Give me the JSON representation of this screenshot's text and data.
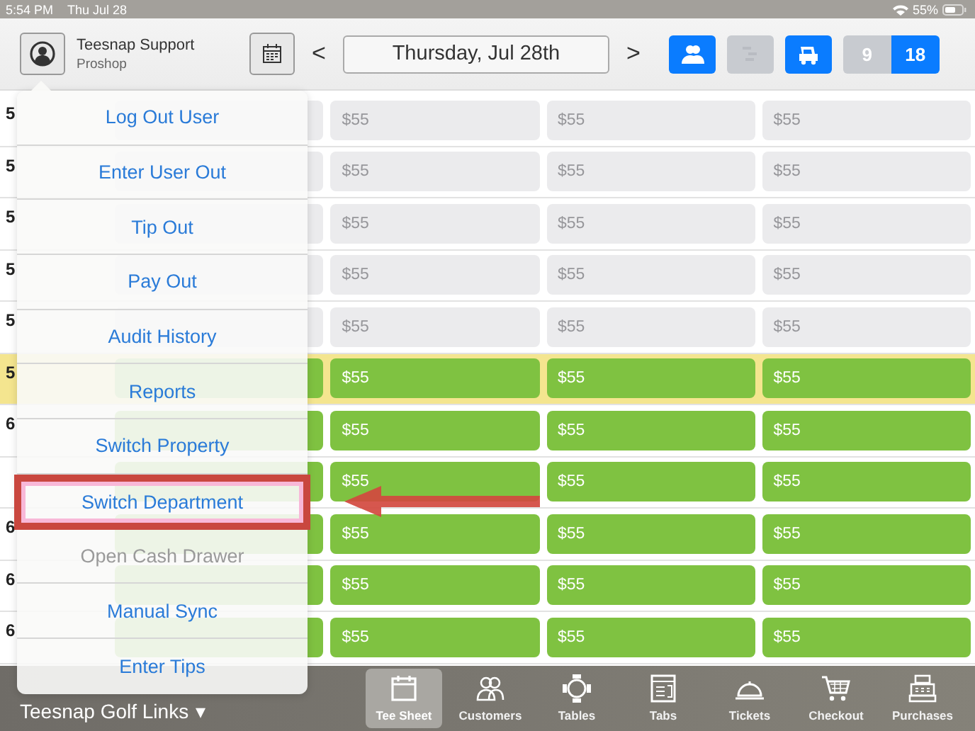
{
  "status_bar": {
    "time": "5:54 PM",
    "date": "Thu Jul 28",
    "battery": "55%"
  },
  "header": {
    "user_name": "Teesnap Support",
    "role": "Proshop",
    "date": "Thursday, Jul 28th",
    "prev": "<",
    "next": ">",
    "toggles": [
      {
        "kind": "players",
        "selected": true
      },
      {
        "kind": "split",
        "selected": false
      },
      {
        "kind": "cart",
        "selected": true
      }
    ],
    "holes": [
      {
        "label": "9",
        "selected": false
      },
      {
        "label": "18",
        "selected": true
      }
    ]
  },
  "tee_sheet": {
    "rows": [
      {
        "label": "5",
        "current": false,
        "booked": false,
        "prices": [
          "$55",
          "$55",
          "$55"
        ]
      },
      {
        "label": "5",
        "current": false,
        "booked": false,
        "prices": [
          "$55",
          "$55",
          "$55"
        ]
      },
      {
        "label": "5",
        "current": false,
        "booked": false,
        "prices": [
          "$55",
          "$55",
          "$55"
        ]
      },
      {
        "label": "5",
        "current": false,
        "booked": false,
        "prices": [
          "$55",
          "$55",
          "$55"
        ]
      },
      {
        "label": "5",
        "current": false,
        "booked": false,
        "prices": [
          "$55",
          "$55",
          "$55"
        ]
      },
      {
        "label": "5",
        "current": true,
        "booked": true,
        "prices": [
          "$55",
          "$55",
          "$55"
        ]
      },
      {
        "label": "6",
        "current": false,
        "booked": true,
        "prices": [
          "$55",
          "$55",
          "$55"
        ]
      },
      {
        "current": false,
        "booked": true,
        "prices": [
          "$55",
          "$55",
          "$55"
        ]
      },
      {
        "label": "6",
        "current": false,
        "booked": true,
        "prices": [
          "$55",
          "$55",
          "$55"
        ]
      },
      {
        "label": "6",
        "current": false,
        "booked": true,
        "prices": [
          "$55",
          "$55",
          "$55"
        ]
      },
      {
        "label": "6",
        "current": false,
        "booked": true,
        "prices": [
          "$55",
          "$55",
          "$55"
        ]
      }
    ]
  },
  "user_menu": {
    "items": [
      {
        "label": "Log Out User",
        "disabled": false,
        "annotated": false
      },
      {
        "label": "Enter User Out",
        "disabled": false,
        "annotated": false
      },
      {
        "label": "Tip Out",
        "disabled": false,
        "annotated": false
      },
      {
        "label": "Pay Out",
        "disabled": false,
        "annotated": false
      },
      {
        "label": "Audit History",
        "disabled": false,
        "annotated": false
      },
      {
        "label": "Reports",
        "disabled": false,
        "annotated": false
      },
      {
        "label": "Switch Property",
        "disabled": false,
        "annotated": false
      },
      {
        "label": "Switch Department",
        "disabled": false,
        "annotated": true
      },
      {
        "label": "Open Cash Drawer",
        "disabled": true,
        "annotated": false
      },
      {
        "label": "Manual Sync",
        "disabled": false,
        "annotated": false
      },
      {
        "label": "Enter Tips",
        "disabled": false,
        "annotated": false
      }
    ]
  },
  "bottom_bar": {
    "course": "Teesnap Golf Links",
    "caret": "▾",
    "tabs": [
      {
        "label": "Tee Sheet",
        "kind": "calendar",
        "selected": true
      },
      {
        "label": "Customers",
        "kind": "people",
        "selected": false
      },
      {
        "label": "Tables",
        "kind": "table",
        "selected": false
      },
      {
        "label": "Tabs",
        "kind": "tabs",
        "selected": false
      },
      {
        "label": "Tickets",
        "kind": "cloche",
        "selected": false
      },
      {
        "label": "Checkout",
        "kind": "cart",
        "selected": false
      },
      {
        "label": "Purchases",
        "kind": "register",
        "selected": false
      }
    ]
  }
}
